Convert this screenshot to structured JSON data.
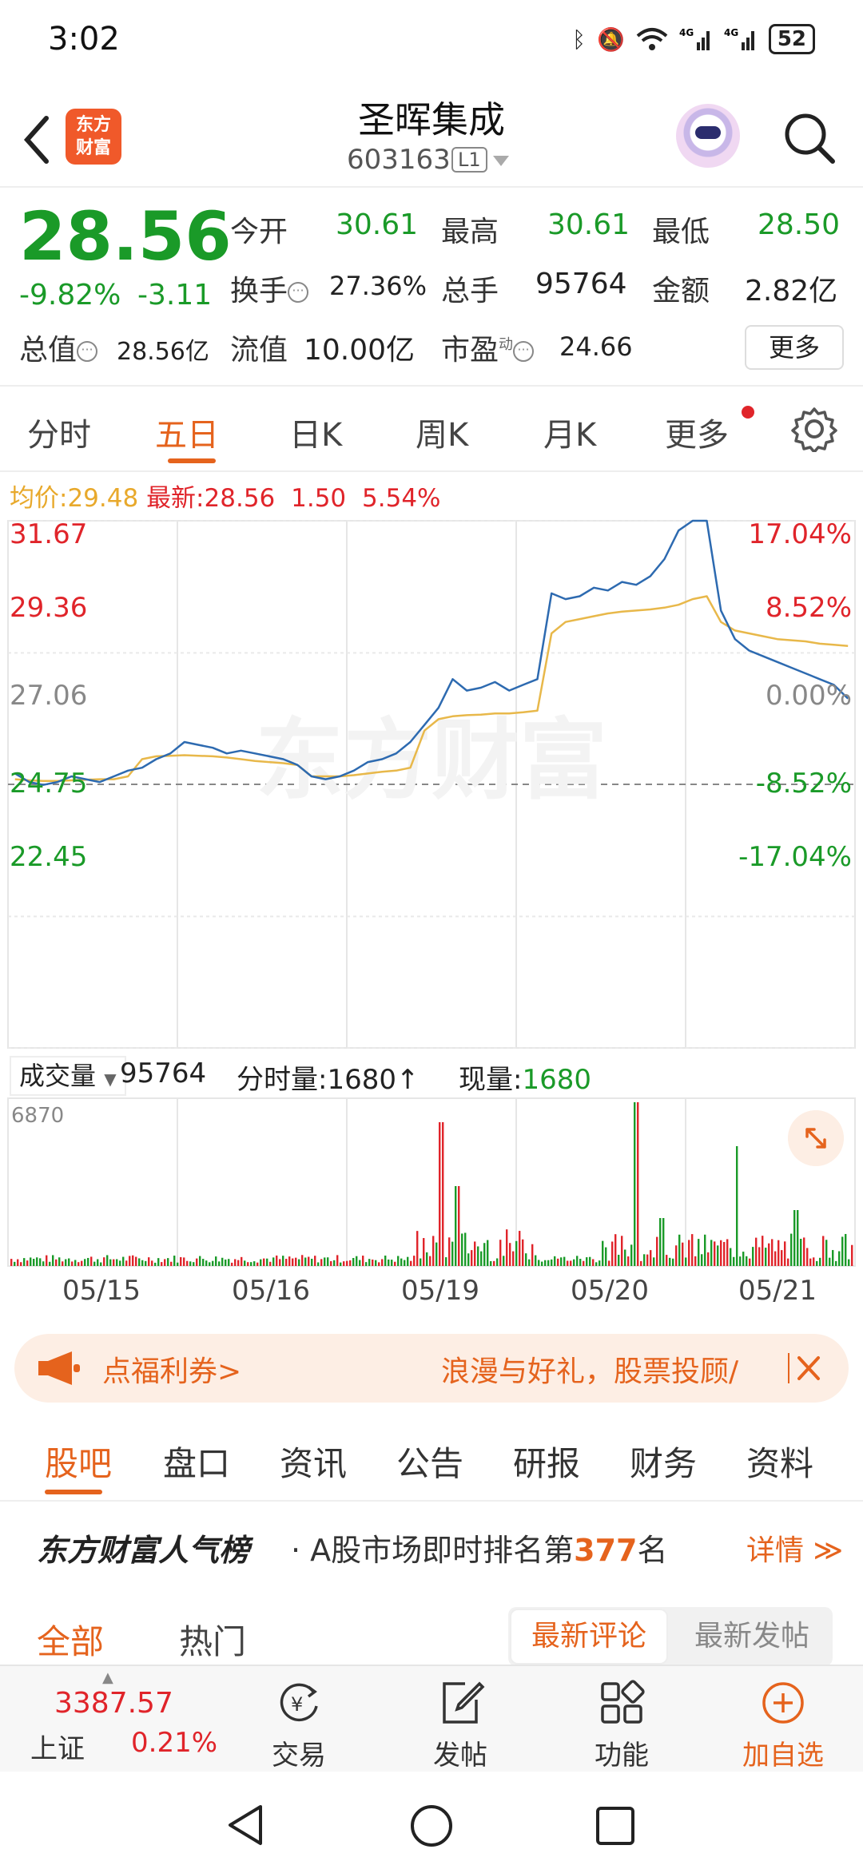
{
  "status_bar": {
    "time": "3:02",
    "battery": "52"
  },
  "header": {
    "logo_text": "东方财富",
    "stock_name": "圣晖集成",
    "stock_code": "603163",
    "level_badge": "L1"
  },
  "quote": {
    "price": "28.56",
    "change_pct": "-9.82%",
    "change_abs": "-3.11",
    "stats": {
      "open_label": "今开",
      "open": "30.61",
      "high_label": "最高",
      "high": "30.61",
      "low_label": "最低",
      "low": "28.50",
      "turnover_label": "换手",
      "turnover": "27.36%",
      "volume_label": "总手",
      "volume": "95764",
      "amount_label": "金额",
      "amount": "2.82亿",
      "mktcap_label": "总值",
      "mktcap": "28.56亿",
      "float_label": "流值",
      "float": "10.00亿",
      "pe_label": "市盈",
      "pe_sup": "动",
      "pe": "24.66"
    },
    "more_label": "更多"
  },
  "chart_tabs": [
    "分时",
    "五日",
    "日K",
    "周K",
    "月K",
    "更多"
  ],
  "active_chart_tab": "五日",
  "legend": {
    "avg_label": "均价:",
    "avg": "29.48",
    "latest_label": "最新:",
    "latest": "28.56",
    "change": "1.50",
    "pct": "5.54%"
  },
  "watermark": "东方财富",
  "chart_data": {
    "type": "line",
    "title": "",
    "price_axis": [
      "31.67",
      "29.36",
      "27.06",
      "24.75",
      "22.45"
    ],
    "pct_axis": [
      "17.04%",
      "8.52%",
      "0.00%",
      "-8.52%",
      "-17.04%"
    ],
    "ylim": [
      22.45,
      31.67
    ],
    "prev_close": 27.06,
    "days": [
      "05/15",
      "05/16",
      "05/19",
      "05/20",
      "05/21"
    ],
    "series": [
      {
        "values": [
          27.25,
          27.1,
          27.05,
          27.1,
          27.2,
          27.15,
          27.1,
          27.2,
          27.3,
          27.35,
          27.5,
          27.6,
          27.8,
          27.75,
          27.7,
          27.6,
          27.65,
          27.6,
          27.55,
          27.5,
          27.4,
          27.2,
          27.15,
          27.2,
          27.3,
          27.45,
          27.5,
          27.6,
          27.8,
          28.1,
          28.4,
          28.9,
          28.7,
          28.75,
          28.85,
          28.7,
          28.8,
          28.9,
          30.4,
          30.3,
          30.35,
          30.5,
          30.45,
          30.6,
          30.55,
          30.7,
          31.0,
          31.5,
          31.67,
          31.67,
          30.1,
          29.6,
          29.4,
          29.3,
          29.2,
          29.1,
          29.0,
          28.9,
          28.8,
          28.56
        ]
      },
      {
        "values": [
          27.15,
          27.13,
          27.12,
          27.12,
          27.13,
          27.14,
          27.15,
          27.15,
          27.2,
          27.5,
          27.55,
          27.56,
          27.57,
          27.56,
          27.55,
          27.53,
          27.5,
          27.47,
          27.45,
          27.43,
          27.4,
          27.2,
          27.2,
          27.2,
          27.22,
          27.25,
          27.28,
          27.3,
          27.35,
          28.0,
          28.2,
          28.25,
          28.27,
          28.28,
          28.3,
          28.3,
          28.32,
          28.35,
          29.7,
          29.9,
          29.95,
          30.0,
          30.05,
          30.08,
          30.1,
          30.12,
          30.15,
          30.2,
          30.3,
          30.35,
          29.9,
          29.75,
          29.7,
          29.65,
          29.6,
          29.58,
          29.56,
          29.52,
          29.5,
          29.48
        ]
      }
    ]
  },
  "volume": {
    "selector_label": "成交量",
    "total": "95764",
    "tick_label": "分时量:",
    "tick_val": "1680",
    "current_label": "现量:",
    "current_val": "1680",
    "axis_max": "6870"
  },
  "promo": {
    "left_text": "点福利券>",
    "right_text": "浪漫与好礼，股票投顾/"
  },
  "section_tabs": [
    "股吧",
    "盘口",
    "资讯",
    "公告",
    "研报",
    "财务",
    "资料"
  ],
  "rank": {
    "title": "东方财富人气榜",
    "text_prefix": "A股市场即时排名第",
    "number": "377",
    "text_suffix": "名",
    "detail": "详情 ≫"
  },
  "filter": {
    "all": "全部",
    "hot": "热门",
    "sort_active": "最新评论",
    "sort_other": "最新发帖"
  },
  "bottom_nav": {
    "index_value": "3387.57",
    "index_name": "上证",
    "index_pct": "0.21%",
    "items": [
      "交易",
      "发帖",
      "功能",
      "加自选"
    ]
  },
  "colors": {
    "up": "#e0242a",
    "down": "#1a9a28",
    "accent": "#e5631d",
    "price_line": "#2d6ab0",
    "avg_line": "#e8b84a"
  }
}
